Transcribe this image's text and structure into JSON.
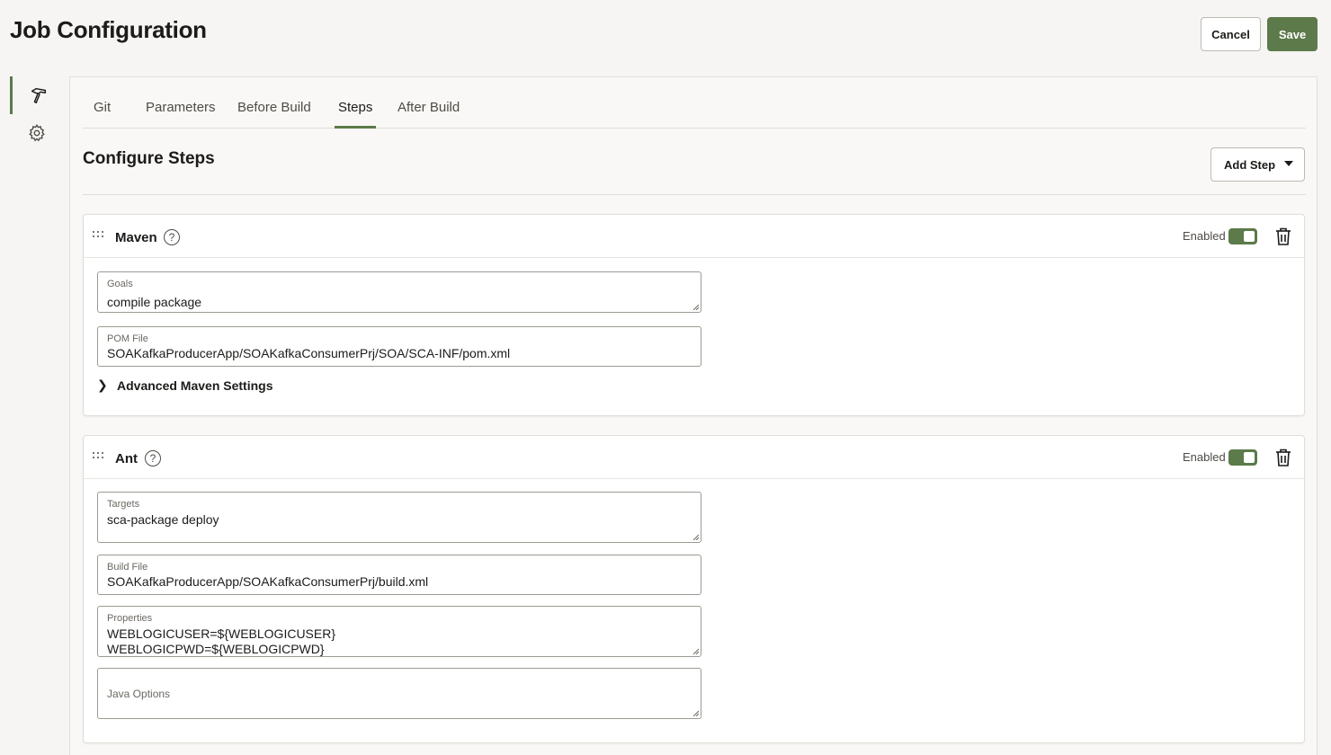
{
  "header": {
    "title": "Job Configuration",
    "cancel_label": "Cancel",
    "save_label": "Save"
  },
  "colors": {
    "accent": "#5c7a4a",
    "background": "#f6f5f3"
  },
  "side_rail": {
    "items": [
      {
        "icon": "hammer-icon",
        "active": true
      },
      {
        "icon": "gear-icon",
        "active": false
      }
    ]
  },
  "tabs": [
    {
      "label": "Git"
    },
    {
      "label": "Parameters"
    },
    {
      "label": "Before Build"
    },
    {
      "label": "Steps",
      "active": true
    },
    {
      "label": "After Build"
    }
  ],
  "section": {
    "title": "Configure Steps",
    "add_step_label": "Add Step"
  },
  "maven": {
    "title": "Maven",
    "enabled_label": "Enabled",
    "enabled": true,
    "goals": {
      "label": "Goals",
      "value": "compile package"
    },
    "pom": {
      "label": "POM File",
      "value": "SOAKafkaProducerApp/SOAKafkaConsumerPrj/SOA/SCA-INF/pom.xml"
    },
    "advanced_label": "Advanced Maven Settings"
  },
  "ant": {
    "title": "Ant",
    "enabled_label": "Enabled",
    "enabled": true,
    "targets": {
      "label": "Targets",
      "value": "sca-package deploy"
    },
    "build_file": {
      "label": "Build File",
      "value": "SOAKafkaProducerApp/SOAKafkaConsumerPrj/build.xml"
    },
    "properties": {
      "label": "Properties",
      "value": "WEBLOGICUSER=${WEBLOGICUSER}\nWEBLOGICPWD=${WEBLOGICPWD}"
    },
    "java_options": {
      "placeholder": "Java Options"
    }
  }
}
